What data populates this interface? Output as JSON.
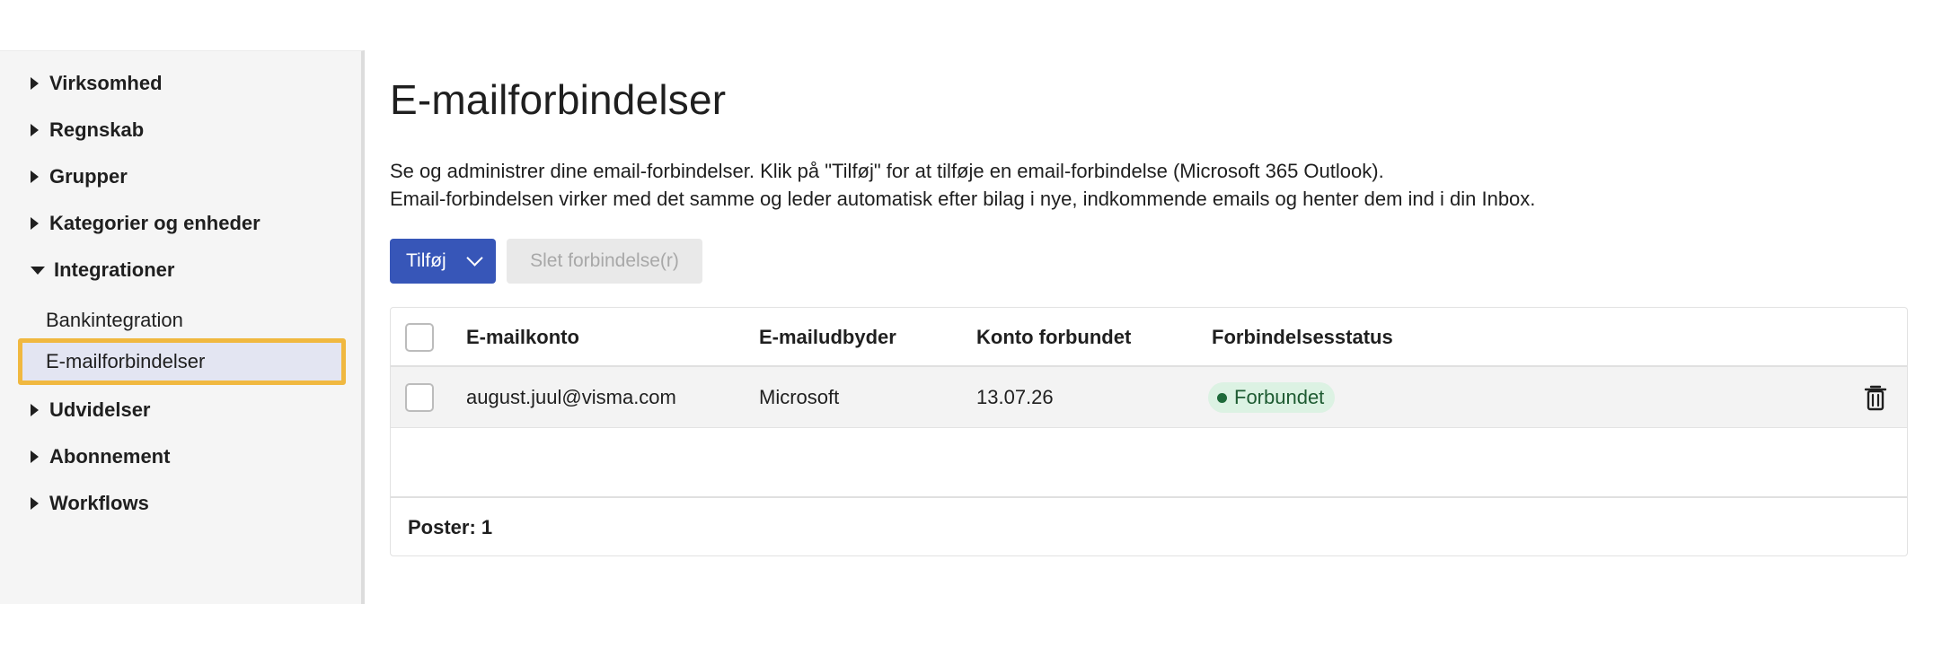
{
  "sidebar": {
    "items": [
      {
        "label": "Virksomhed",
        "expanded": false
      },
      {
        "label": "Regnskab",
        "expanded": false
      },
      {
        "label": "Grupper",
        "expanded": false
      },
      {
        "label": "Kategorier og enheder",
        "expanded": false
      },
      {
        "label": "Integrationer",
        "expanded": true
      },
      {
        "label": "Udvidelser",
        "expanded": false
      },
      {
        "label": "Abonnement",
        "expanded": false
      },
      {
        "label": "Workflows",
        "expanded": false
      }
    ],
    "subitems": [
      {
        "label": "Bankintegration",
        "active": false
      },
      {
        "label": "E-mailforbindelser",
        "active": true
      }
    ],
    "highlight_color": "#f0b840"
  },
  "main": {
    "title": "E-mailforbindelser",
    "description_line1": "Se og administrer dine email-forbindelser. Klik på \"Tilføj\" for at tilføje en email-forbindelse (Microsoft 365 Outlook).",
    "description_line2": "Email-forbindelsen virker med det samme og leder automatisk efter bilag i nye, indkommende emails og henter dem ind i din Inbox.",
    "add_button_label": "Tilføj",
    "delete_button_label": "Slet forbindelse(r)",
    "accent_color": "#3756b8"
  },
  "table": {
    "columns": [
      "E-mailkonto",
      "E-mailudbyder",
      "Konto forbundet",
      "Forbindelsesstatus"
    ],
    "rows": [
      {
        "account": "august.juul@visma.com",
        "provider": "Microsoft",
        "connected": "13.07.26",
        "status": "Forbundet",
        "status_color": "#1e6a3a"
      }
    ],
    "footer": "Poster: 1"
  }
}
